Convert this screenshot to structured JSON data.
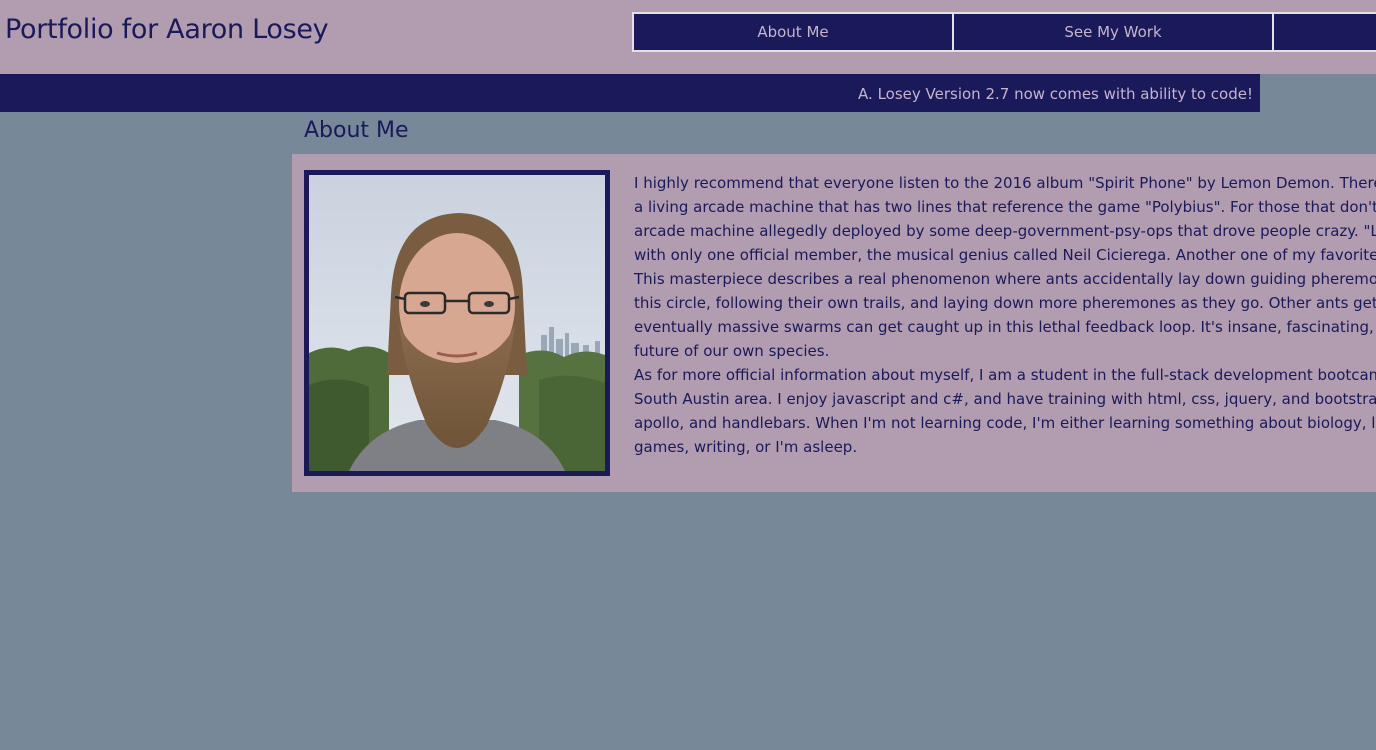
{
  "header": {
    "title": "Portfolio for Aaron Losey",
    "nav": [
      {
        "label": "About Me"
      },
      {
        "label": "See My Work"
      },
      {
        "label": ""
      }
    ]
  },
  "banner": {
    "text": "A. Losey Version 2.7 now comes with ability to code!"
  },
  "about": {
    "heading": "About Me",
    "photo_icon": "profile-photo",
    "lines": [
      "I highly recommend that everyone listen to the 2016 album \"Spirit Phone\" by Lemon Demon. There's a so",
      "a living arcade machine that has two lines that reference the game \"Polybius\". For those that don't know,",
      "arcade machine allegedly deployed by some deep-government-psy-ops that drove people crazy. \"Lemon",
      "with only one official member, the musical genius called Neil Cicierega. Another one of my favorite songs",
      "This masterpiece describes a real phenomenon where ants accidentally lay down guiding pheremones in a",
      "this circle, following their own trails, and laying down more pheremones as they go. Other ants get sucked",
      "eventually massive swarms can get caught up in this lethal feedback loop. It's insane, fascinating, and the",
      "future of our own species.",
      "As for more official information about myself, I am a student in the full-stack development bootcamp at U",
      "South Austin area. I enjoy javascript and c#, and have training with html, css, jquery, and bootstrap, expres",
      "apollo, and handlebars. When I'm not learning code, I'm either learning something about biology, learnin",
      "games, writing, or I'm asleep."
    ]
  },
  "colors": {
    "background": "#778899",
    "header_bg": "#b19cb0",
    "navy": "#1a1a5a",
    "nav_text": "#c6b3cc"
  }
}
